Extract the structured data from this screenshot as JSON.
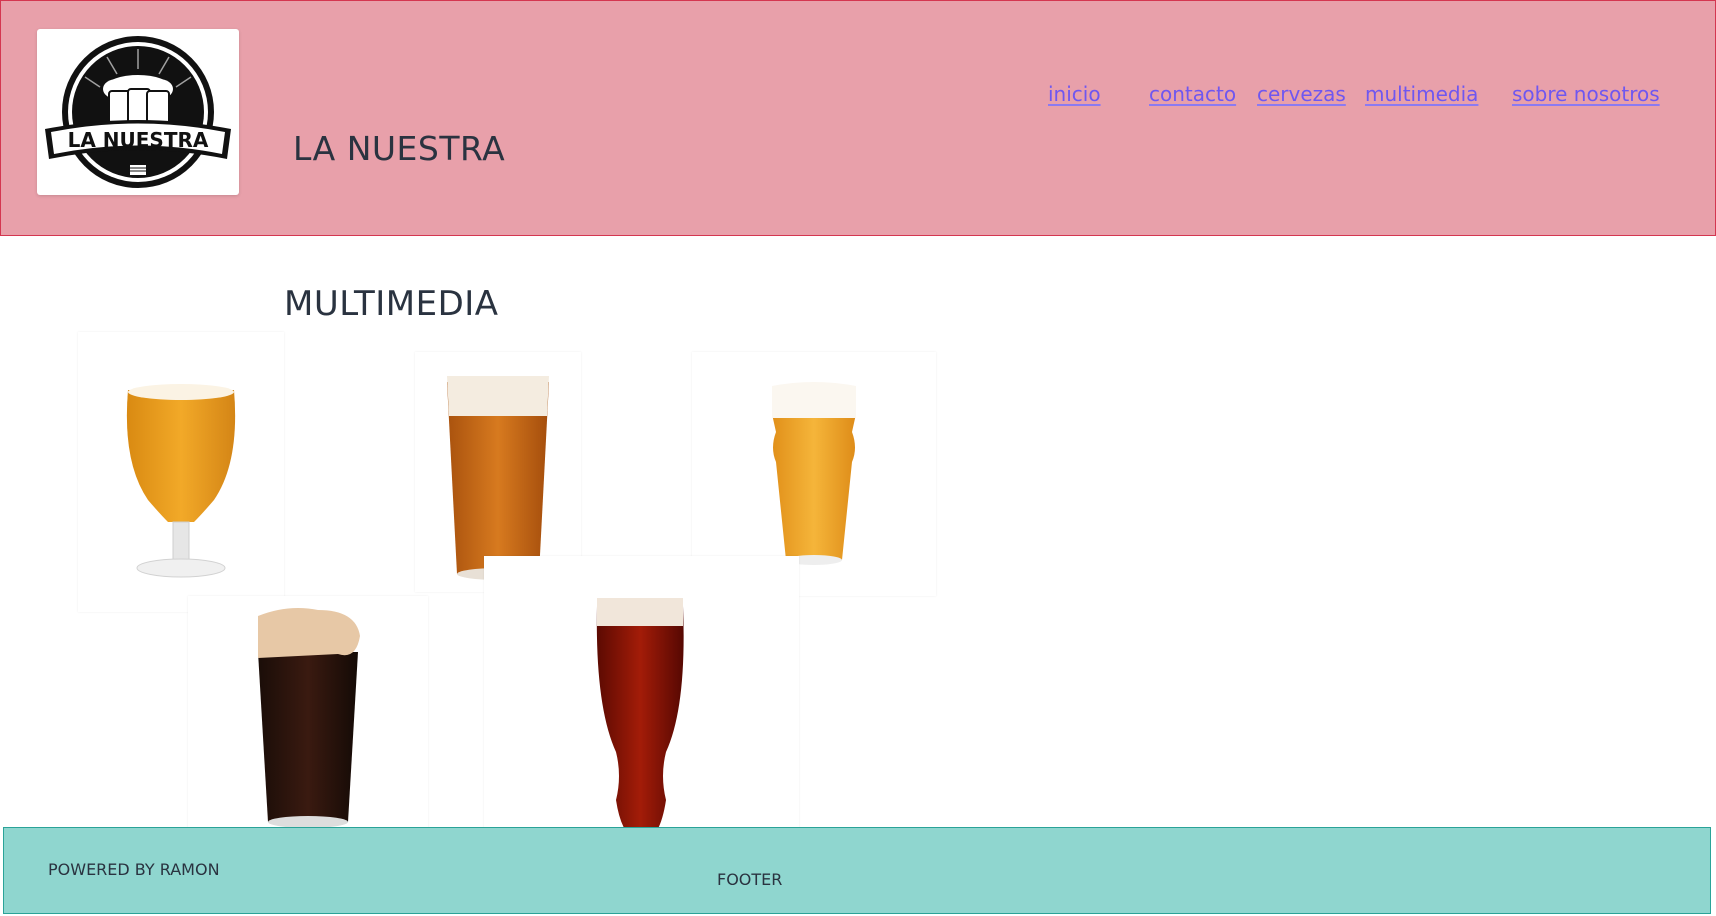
{
  "brand": {
    "logo_text": "LA NUESTRA",
    "title": "LA NUESTRA"
  },
  "nav": {
    "items": [
      {
        "label": "inicio"
      },
      {
        "label": "contacto"
      },
      {
        "label": "cervezas"
      },
      {
        "label": "multimedia"
      },
      {
        "label": "sobre nosotros"
      }
    ]
  },
  "main": {
    "heading": "MULTIMEDIA",
    "gallery": [
      {
        "icon": "tulip-glass-golden-beer"
      },
      {
        "icon": "pint-glass-amber-beer"
      },
      {
        "icon": "nonic-pint-golden-beer"
      },
      {
        "icon": "pint-glass-stout"
      },
      {
        "icon": "pilsner-glass-red-beer"
      }
    ]
  },
  "footer": {
    "credit": "POWERED BY RAMON",
    "label": "FOOTER"
  },
  "colors": {
    "header_bg": "#e8a0aa",
    "header_border": "#d43650",
    "nav_link": "#6f57f0",
    "footer_bg": "#8fd6cf",
    "footer_border": "#2aa398",
    "text": "#2a3340"
  }
}
